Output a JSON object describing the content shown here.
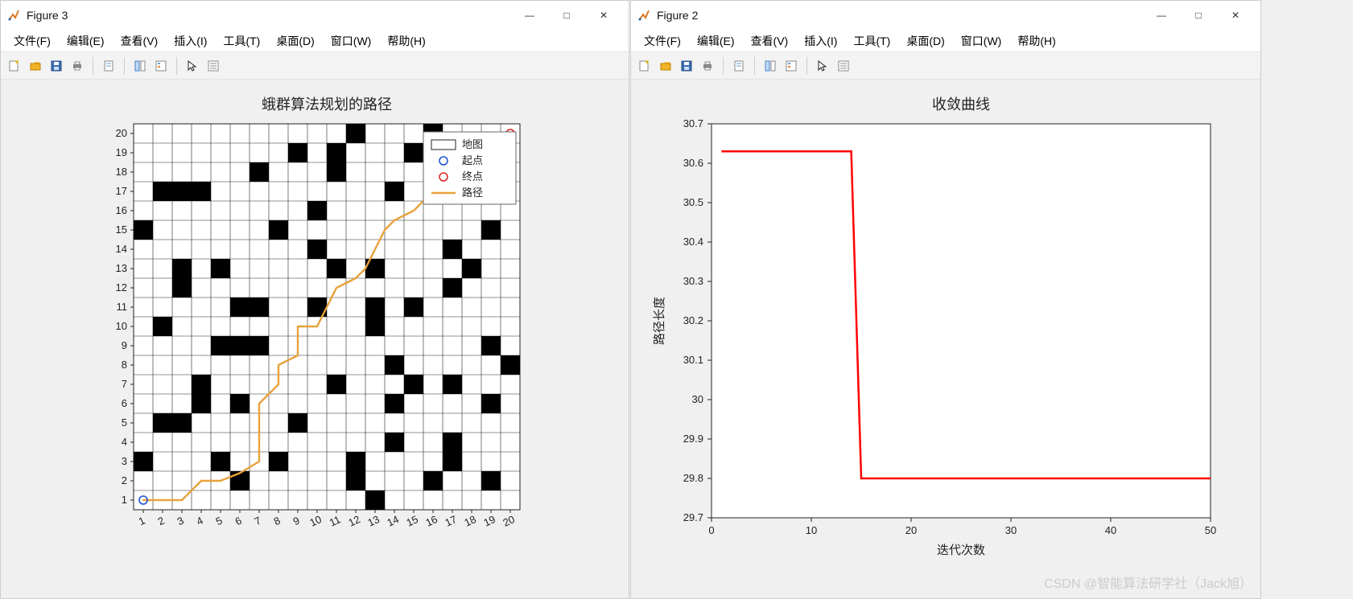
{
  "window_left": {
    "title": "Figure 3"
  },
  "window_right": {
    "title": "Figure 2"
  },
  "menu": {
    "file": "文件(F)",
    "edit": "编辑(E)",
    "view": "查看(V)",
    "insert": "插入(I)",
    "tools": "工具(T)",
    "desktop": "桌面(D)",
    "window": "窗口(W)",
    "help": "帮助(H)"
  },
  "chart_data": [
    {
      "type": "heatmap",
      "title": "蛾群算法规划的路径",
      "x_ticks": [
        1,
        2,
        3,
        4,
        5,
        6,
        7,
        8,
        9,
        10,
        11,
        12,
        13,
        14,
        15,
        16,
        17,
        18,
        19,
        20
      ],
      "y_ticks": [
        1,
        2,
        3,
        4,
        5,
        6,
        7,
        8,
        9,
        10,
        11,
        12,
        13,
        14,
        15,
        16,
        17,
        18,
        19,
        20
      ],
      "obstacles": [
        [
          1,
          3
        ],
        [
          1,
          15
        ],
        [
          2,
          5
        ],
        [
          2,
          10
        ],
        [
          2,
          17
        ],
        [
          3,
          13
        ],
        [
          3,
          17
        ],
        [
          4,
          17
        ],
        [
          5,
          3
        ],
        [
          5,
          9
        ],
        [
          5,
          13
        ],
        [
          6,
          9
        ],
        [
          6,
          11
        ],
        [
          7,
          9
        ],
        [
          7,
          18
        ],
        [
          8,
          15
        ],
        [
          9,
          5
        ],
        [
          9,
          19
        ],
        [
          10,
          11
        ],
        [
          10,
          16
        ],
        [
          11,
          7
        ],
        [
          11,
          13
        ],
        [
          11,
          18
        ],
        [
          11,
          19
        ],
        [
          12,
          3
        ],
        [
          12,
          20
        ],
        [
          13,
          1
        ],
        [
          13,
          11
        ],
        [
          14,
          4
        ],
        [
          14,
          8
        ],
        [
          14,
          17
        ],
        [
          15,
          7
        ],
        [
          15,
          11
        ],
        [
          15,
          19
        ],
        [
          16,
          2
        ],
        [
          16,
          20
        ],
        [
          17,
          3
        ],
        [
          17,
          7
        ],
        [
          17,
          12
        ],
        [
          18,
          13
        ],
        [
          19,
          2
        ],
        [
          19,
          6
        ],
        [
          19,
          9
        ],
        [
          19,
          15
        ],
        [
          20,
          8
        ],
        [
          6,
          2
        ],
        [
          12,
          2
        ],
        [
          8,
          3
        ],
        [
          17,
          4
        ],
        [
          3,
          5
        ],
        [
          4,
          6
        ],
        [
          6,
          6
        ],
        [
          14,
          6
        ],
        [
          4,
          7
        ],
        [
          13,
          10
        ],
        [
          7,
          11
        ],
        [
          3,
          12
        ],
        [
          13,
          13
        ],
        [
          10,
          14
        ],
        [
          17,
          14
        ]
      ],
      "start": [
        1,
        1
      ],
      "end": [
        20,
        20
      ],
      "path": [
        [
          1,
          1
        ],
        [
          2,
          1
        ],
        [
          3,
          1
        ],
        [
          4,
          2
        ],
        [
          5,
          2
        ],
        [
          6,
          2.4
        ],
        [
          7,
          3
        ],
        [
          7,
          4
        ],
        [
          7,
          5
        ],
        [
          7,
          6
        ],
        [
          8,
          7
        ],
        [
          8,
          8
        ],
        [
          9,
          8.5
        ],
        [
          9,
          9
        ],
        [
          9,
          10
        ],
        [
          10,
          10
        ],
        [
          10.5,
          11
        ],
        [
          11,
          12
        ],
        [
          12,
          12.5
        ],
        [
          12.5,
          13
        ],
        [
          13,
          14
        ],
        [
          13.5,
          15
        ],
        [
          14,
          15.5
        ],
        [
          15,
          16
        ],
        [
          16,
          17
        ],
        [
          17,
          17.5
        ],
        [
          18,
          18
        ],
        [
          19,
          19
        ],
        [
          20,
          20
        ]
      ],
      "legend": {
        "map": "地图",
        "start": "起点",
        "end": "终点",
        "path": "路径"
      }
    },
    {
      "type": "line",
      "title": "收敛曲线",
      "xlabel": "迭代次数",
      "ylabel": "路径长度",
      "xlim": [
        0,
        50
      ],
      "ylim": [
        29.7,
        30.7
      ],
      "x_ticks": [
        0,
        10,
        20,
        30,
        40,
        50
      ],
      "y_ticks": [
        29.7,
        29.8,
        29.9,
        30,
        30.1,
        30.2,
        30.3,
        30.4,
        30.5,
        30.6,
        30.7
      ],
      "series": [
        {
          "name": "路径长度",
          "color": "#ff0000",
          "x": [
            1,
            2,
            3,
            4,
            5,
            6,
            7,
            8,
            9,
            10,
            11,
            12,
            13,
            14,
            15,
            16,
            17,
            18,
            19,
            20,
            21,
            22,
            23,
            24,
            25,
            26,
            27,
            28,
            29,
            30,
            31,
            32,
            33,
            34,
            35,
            36,
            37,
            38,
            39,
            40,
            41,
            42,
            43,
            44,
            45,
            46,
            47,
            48,
            49,
            50
          ],
          "y": [
            30.63,
            30.63,
            30.63,
            30.63,
            30.63,
            30.63,
            30.63,
            30.63,
            30.63,
            30.63,
            30.63,
            30.63,
            30.63,
            30.63,
            29.8,
            29.8,
            29.8,
            29.8,
            29.8,
            29.8,
            29.8,
            29.8,
            29.8,
            29.8,
            29.8,
            29.8,
            29.8,
            29.8,
            29.8,
            29.8,
            29.8,
            29.8,
            29.8,
            29.8,
            29.8,
            29.8,
            29.8,
            29.8,
            29.8,
            29.8,
            29.8,
            29.8,
            29.8,
            29.8,
            29.8,
            29.8,
            29.8,
            29.8,
            29.8,
            29.8
          ]
        }
      ]
    }
  ],
  "watermark": "CSDN @智能算法研学社（Jack旭）"
}
